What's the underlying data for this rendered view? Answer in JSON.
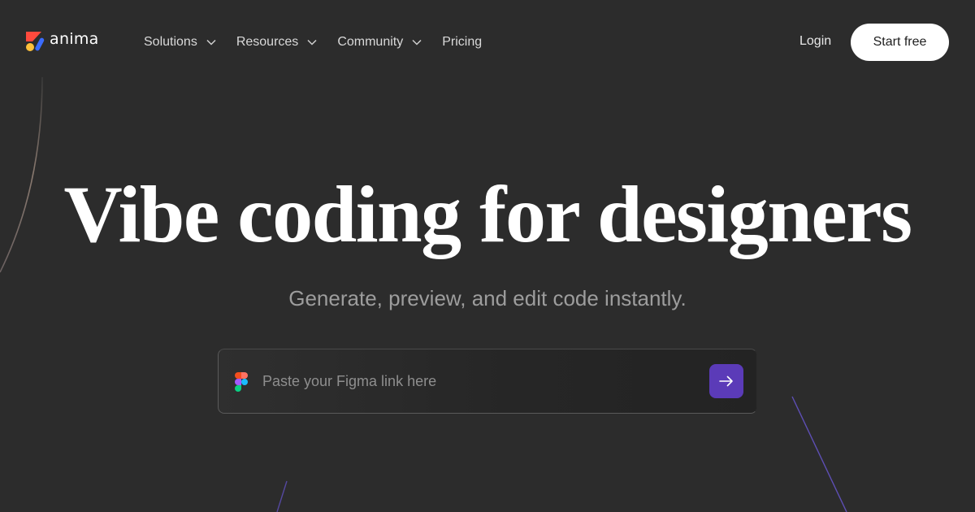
{
  "brand": {
    "name": "anima"
  },
  "nav": {
    "items": [
      {
        "label": "Solutions",
        "has_dropdown": true
      },
      {
        "label": "Resources",
        "has_dropdown": true
      },
      {
        "label": "Community",
        "has_dropdown": true
      },
      {
        "label": "Pricing",
        "has_dropdown": false
      }
    ],
    "login_label": "Login",
    "cta_label": "Start free"
  },
  "hero": {
    "title": "Vibe coding for designers",
    "subtitle": "Generate, preview, and edit code instantly."
  },
  "link_input": {
    "placeholder": "Paste your Figma link here",
    "value": ""
  },
  "icons": {
    "logo": "anima-logo-icon",
    "menu_chevron": "chevron-down-icon",
    "input_icon": "figma-icon",
    "submit": "arrow-right-icon"
  },
  "colors": {
    "background": "#2c2c2c",
    "accent": "#5b3bb8",
    "cta_background": "#ffffff",
    "cta_text": "#1e1e1e"
  }
}
